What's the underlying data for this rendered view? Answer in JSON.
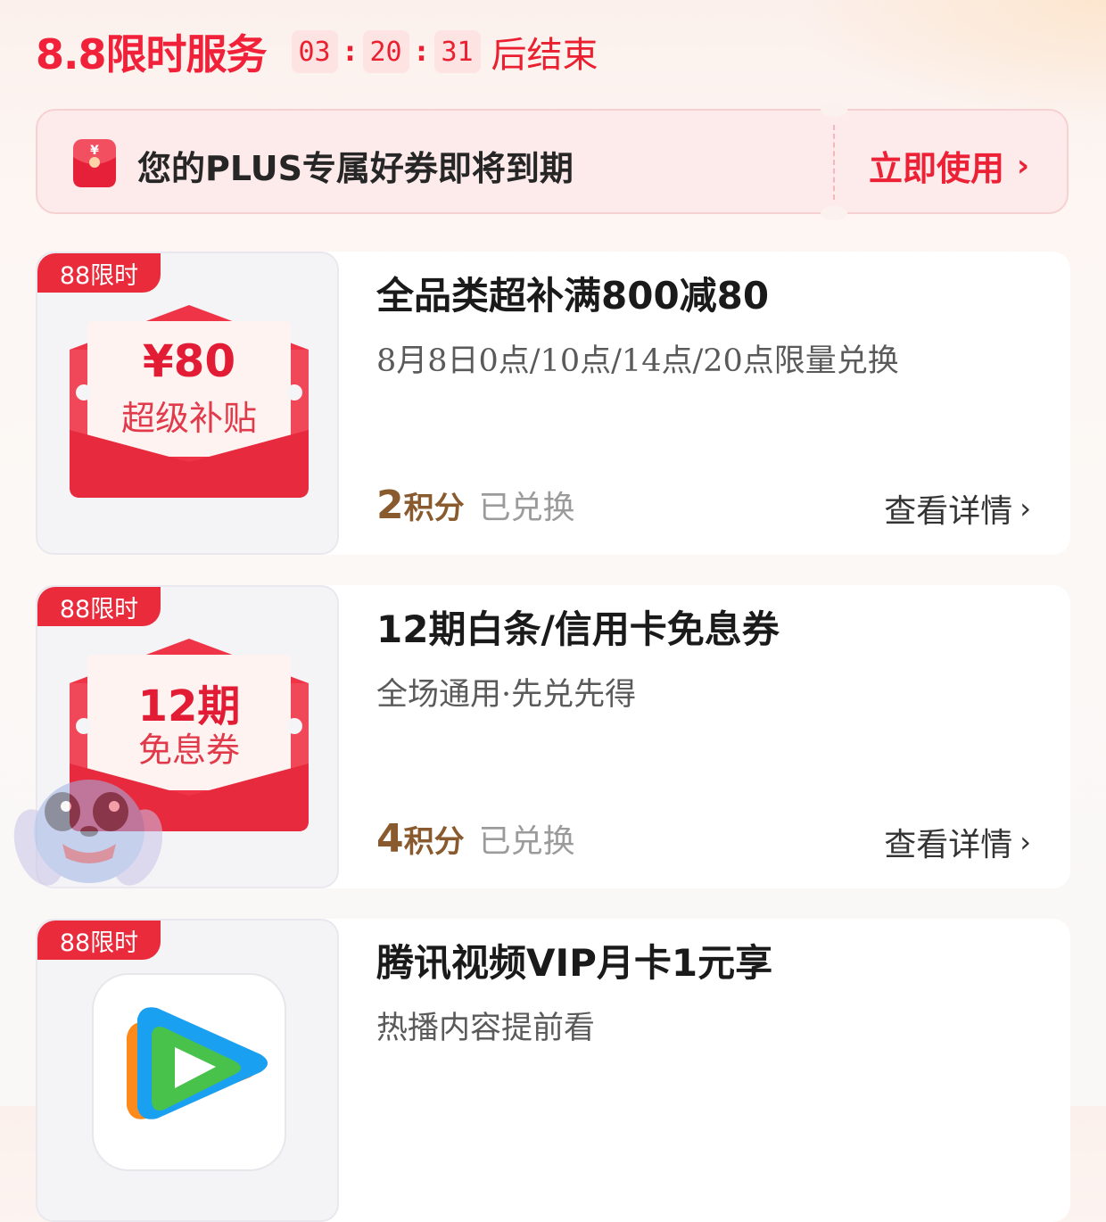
{
  "header": {
    "title": "8.8限时服务",
    "timer": {
      "hours": "03",
      "minutes": "20",
      "seconds": "31",
      "separator": ":"
    },
    "timer_suffix": "后结束"
  },
  "banner": {
    "icon": "red-envelope-icon",
    "icon_glyph": "¥",
    "text": "您的PLUS专属好券即将到期",
    "action_label": "立即使用",
    "action_chevron": "›"
  },
  "cards": [
    {
      "tag": "88限时",
      "thumb": {
        "type": "red-envelope",
        "line1": "¥80",
        "line2": "超级补贴"
      },
      "title": "全品类超补满800减80",
      "subtitle": "8月8日0点/10点/14点/20点限量兑换",
      "points": "2",
      "points_unit": "积分",
      "status": "已兑换",
      "detail_label": "查看详情",
      "detail_chevron": "›"
    },
    {
      "tag": "88限时",
      "thumb": {
        "type": "red-envelope",
        "line1": "12期",
        "line2": "免息券"
      },
      "title": "12期白条/信用卡免息券",
      "subtitle": "全场通用·先兑先得",
      "points": "4",
      "points_unit": "积分",
      "status": "已兑换",
      "detail_label": "查看详情",
      "detail_chevron": "›"
    },
    {
      "tag": "88限时",
      "thumb": {
        "type": "app-icon",
        "icon": "tencent-video-icon"
      },
      "title": "腾讯视频VIP月卡1元享",
      "subtitle": "热播内容提前看"
    }
  ],
  "colors": {
    "accent_red": "#f1213a",
    "timer_bg": "#fde4e3",
    "banner_bg": "#fdeaea",
    "points_brown": "#8a5a2f",
    "muted_gray": "#9b9b9b"
  }
}
